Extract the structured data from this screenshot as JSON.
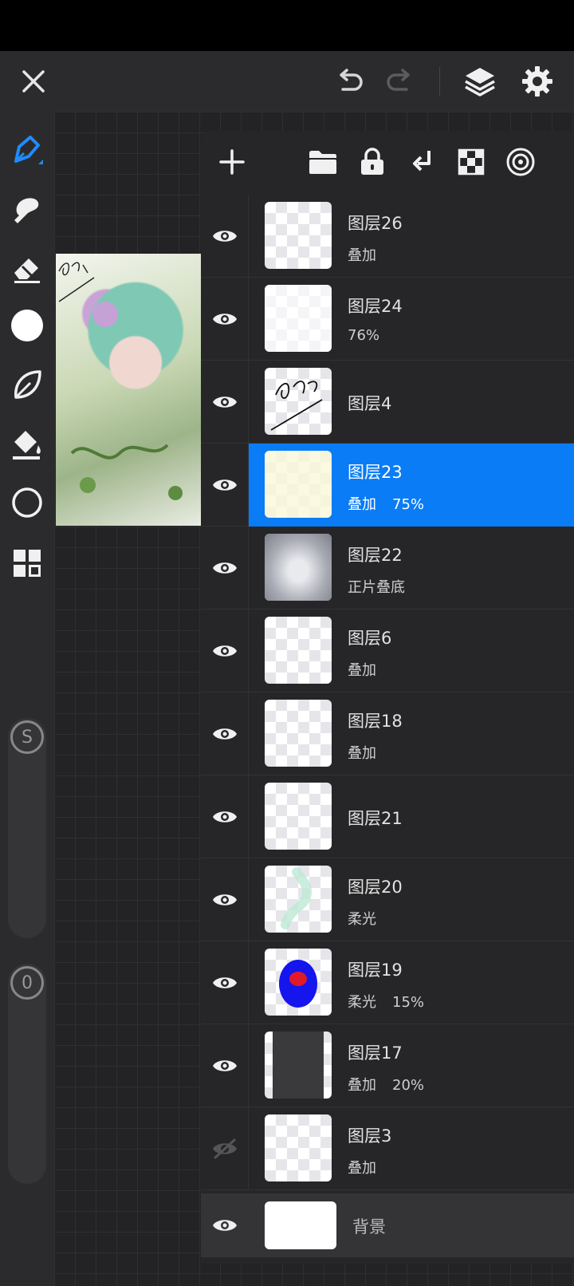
{
  "colors": {
    "accent": "#0a7cf5",
    "panel": "#262628",
    "toolbar": "#2b2b2d"
  },
  "top_bar": {
    "icons": [
      "close-icon",
      "undo-icon",
      "redo-icon",
      "layers-icon",
      "gear-icon"
    ]
  },
  "left_toolbar": {
    "tools": [
      "brush-icon",
      "smudge-icon",
      "eraser-icon",
      "color-swatch",
      "leaf-icon",
      "bucket-icon",
      "ellipse-icon",
      "grid-icon"
    ],
    "size_slider_label": "S",
    "opacity_slider_label": "0"
  },
  "layers_panel": {
    "toolbar_icons": [
      "add-icon",
      "folder-icon",
      "lock-icon",
      "merge-down-icon",
      "checker-icon",
      "target-icon"
    ],
    "layers": [
      {
        "name": "图层26",
        "mode": "叠加",
        "opacity": "",
        "visible": true,
        "selected": false
      },
      {
        "name": "图层24",
        "mode": "76%",
        "opacity": "",
        "visible": true,
        "selected": false
      },
      {
        "name": "图层4",
        "mode": "",
        "opacity": "",
        "visible": true,
        "selected": false
      },
      {
        "name": "图层23",
        "mode": "叠加",
        "opacity": "75%",
        "visible": true,
        "selected": true
      },
      {
        "name": "图层22",
        "mode": "正片叠底",
        "opacity": "",
        "visible": true,
        "selected": false
      },
      {
        "name": "图层6",
        "mode": "叠加",
        "opacity": "",
        "visible": true,
        "selected": false
      },
      {
        "name": "图层18",
        "mode": "叠加",
        "opacity": "",
        "visible": true,
        "selected": false
      },
      {
        "name": "图层21",
        "mode": "",
        "opacity": "",
        "visible": true,
        "selected": false
      },
      {
        "name": "图层20",
        "mode": "柔光",
        "opacity": "",
        "visible": true,
        "selected": false
      },
      {
        "name": "图层19",
        "mode": "柔光",
        "opacity": "15%",
        "visible": true,
        "selected": false
      },
      {
        "name": "图层17",
        "mode": "叠加",
        "opacity": "20%",
        "visible": true,
        "selected": false
      },
      {
        "name": "图层3",
        "mode": "叠加",
        "opacity": "",
        "visible": false,
        "selected": false
      }
    ],
    "background_label": "背景"
  }
}
